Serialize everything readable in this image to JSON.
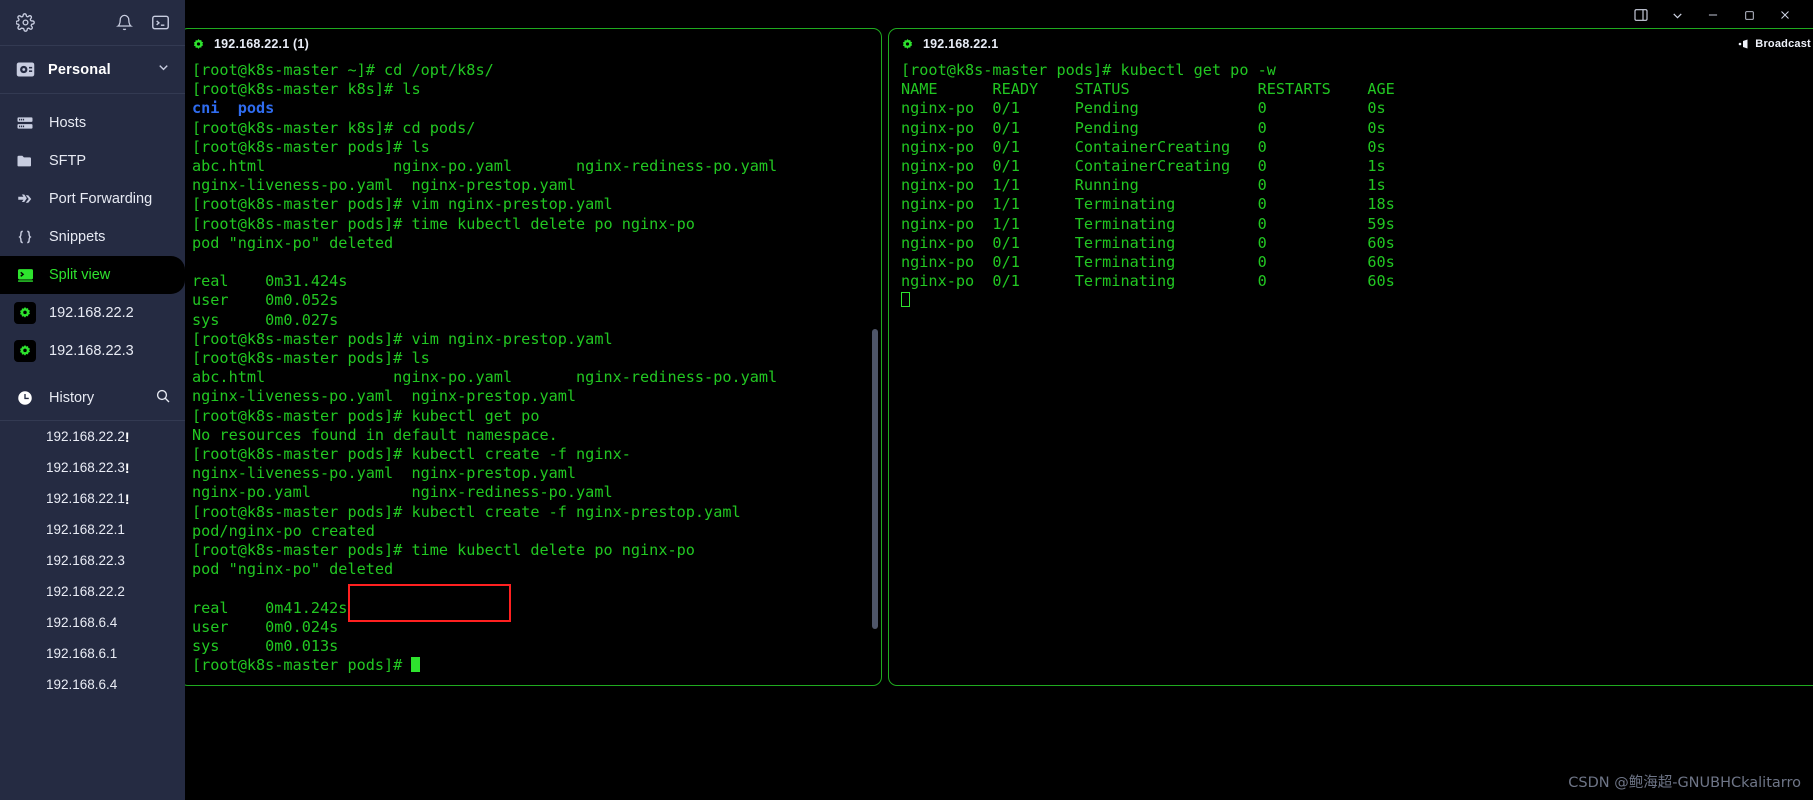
{
  "window": {
    "controls": [
      {
        "name": "layout-panel-icon",
        "glyph": "layout"
      },
      {
        "name": "chevron-down-icon",
        "glyph": "chevron"
      },
      {
        "name": "minimize-icon",
        "glyph": "minimize"
      },
      {
        "name": "maximize-icon",
        "glyph": "maximize"
      },
      {
        "name": "close-icon",
        "glyph": "close"
      }
    ]
  },
  "sidebar": {
    "top_icons": [
      {
        "name": "settings-gear-icon",
        "label": "Settings"
      },
      {
        "name": "notifications-bell-icon",
        "label": "Notifications"
      },
      {
        "name": "terminal-icon",
        "label": "Terminal"
      }
    ],
    "profile": {
      "label": "Personal",
      "icon": "vault-icon"
    },
    "nav": [
      {
        "label": "Hosts",
        "icon": "server-icon",
        "active": false
      },
      {
        "label": "SFTP",
        "icon": "folder-icon",
        "active": false
      },
      {
        "label": "Port Forwarding",
        "icon": "port-forward-icon",
        "active": false
      },
      {
        "label": "Snippets",
        "icon": "braces-icon",
        "active": false
      },
      {
        "label": "Split view",
        "icon": "split-terminal-icon",
        "active": true
      }
    ],
    "hosts": [
      {
        "label": "192.168.22.2"
      },
      {
        "label": "192.168.22.3"
      }
    ],
    "history": {
      "label": "History",
      "icon": "clock-icon",
      "search_icon": "search-icon",
      "items": [
        {
          "label": "192.168.22.2",
          "alert": "!"
        },
        {
          "label": "192.168.22.3",
          "alert": "!"
        },
        {
          "label": "192.168.22.1",
          "alert": "!"
        },
        {
          "label": "192.168.22.1",
          "alert": ""
        },
        {
          "label": "192.168.22.3",
          "alert": ""
        },
        {
          "label": "192.168.22.2",
          "alert": ""
        },
        {
          "label": "192.168.6.4",
          "alert": ""
        },
        {
          "label": "192.168.6.1",
          "alert": ""
        },
        {
          "label": "192.168.6.4",
          "alert": ""
        }
      ]
    }
  },
  "panes": {
    "left": {
      "title": "192.168.22.1 (1)",
      "icon": "ssh-host-icon",
      "lines": [
        "[root@k8s-master ~]# cd /opt/k8s/",
        "[root@k8s-master k8s]# ls",
        "__DIR__cni  pods",
        "[root@k8s-master k8s]# cd pods/",
        "[root@k8s-master pods]# ls",
        "abc.html              nginx-po.yaml       nginx-rediness-po.yaml",
        "nginx-liveness-po.yaml  nginx-prestop.yaml",
        "[root@k8s-master pods]# vim nginx-prestop.yaml",
        "[root@k8s-master pods]# time kubectl delete po nginx-po",
        "pod \"nginx-po\" deleted",
        "",
        "real    0m31.424s",
        "user    0m0.052s",
        "sys     0m0.027s",
        "[root@k8s-master pods]# vim nginx-prestop.yaml",
        "[root@k8s-master pods]# ls",
        "abc.html              nginx-po.yaml       nginx-rediness-po.yaml",
        "nginx-liveness-po.yaml  nginx-prestop.yaml",
        "[root@k8s-master pods]# kubectl get po",
        "No resources found in default namespace.",
        "[root@k8s-master pods]# kubectl create -f nginx-",
        "nginx-liveness-po.yaml  nginx-prestop.yaml",
        "nginx-po.yaml           nginx-rediness-po.yaml",
        "[root@k8s-master pods]# kubectl create -f nginx-prestop.yaml",
        "pod/nginx-po created",
        "[root@k8s-master pods]# time kubectl delete po nginx-po",
        "pod \"nginx-po\" deleted",
        "",
        "real    0m41.242s",
        "user    0m0.024s",
        "sys     0m0.013s",
        "[root@k8s-master pods]# __CURSOR__"
      ]
    },
    "right": {
      "title": "192.168.22.1",
      "icon": "ssh-host-icon",
      "broadcast_label": "Broadcast",
      "close_label": "✕",
      "command": "[root@k8s-master pods]# kubectl get po -w",
      "table": {
        "headers": [
          "NAME",
          "READY",
          "STATUS",
          "RESTARTS",
          "AGE"
        ],
        "rows": [
          [
            "nginx-po",
            "0/1",
            "Pending",
            "0",
            "0s"
          ],
          [
            "nginx-po",
            "0/1",
            "Pending",
            "0",
            "0s"
          ],
          [
            "nginx-po",
            "0/1",
            "ContainerCreating",
            "0",
            "0s"
          ],
          [
            "nginx-po",
            "0/1",
            "ContainerCreating",
            "0",
            "1s"
          ],
          [
            "nginx-po",
            "1/1",
            "Running",
            "0",
            "1s"
          ],
          [
            "nginx-po",
            "1/1",
            "Terminating",
            "0",
            "18s"
          ],
          [
            "nginx-po",
            "1/1",
            "Terminating",
            "0",
            "59s"
          ],
          [
            "nginx-po",
            "0/1",
            "Terminating",
            "0",
            "60s"
          ],
          [
            "nginx-po",
            "0/1",
            "Terminating",
            "0",
            "60s"
          ],
          [
            "nginx-po",
            "0/1",
            "Terminating",
            "0",
            "60s"
          ]
        ]
      }
    }
  },
  "annotation": {
    "name": "red-highlight-box",
    "color": "#ff2020"
  },
  "watermark": "CSDN @鲍海超-GNUBHCkalitarro",
  "colors": {
    "sidebar_bg": "#252b42",
    "terminal_green": "#22c722",
    "accent_green": "#2ee32e",
    "dir_blue": "#2f6cf0",
    "annotation_red": "#ff2020"
  }
}
